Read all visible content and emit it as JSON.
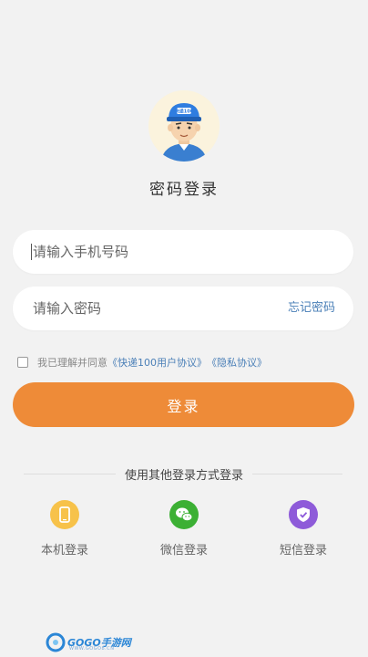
{
  "header": {
    "title": "密码登录",
    "avatar_badge": "快递100"
  },
  "form": {
    "phone_placeholder": "请输入手机号码",
    "password_placeholder": "请输入密码",
    "forgot_label": "忘记密码"
  },
  "agreement": {
    "prefix": "我已理解并同意",
    "user_agreement": "《快递100用户协议》",
    "privacy_policy": "《隐私协议》",
    "checked": false
  },
  "login_button": "登录",
  "alt_login": {
    "divider_text": "使用其他登录方式登录",
    "options": [
      {
        "label": "本机登录",
        "icon": "phone-icon",
        "color": "#f7c24a"
      },
      {
        "label": "微信登录",
        "icon": "wechat-icon",
        "color": "#3cb034"
      },
      {
        "label": "短信登录",
        "icon": "shield-check-icon",
        "color": "#8e5bd9"
      }
    ]
  },
  "watermark": {
    "text": "GOGO手游网",
    "sub": "WWW.GOGO8.CN"
  },
  "colors": {
    "accent": "#ee8b38",
    "link": "#4a7fb7",
    "background": "#f2f2f2"
  }
}
